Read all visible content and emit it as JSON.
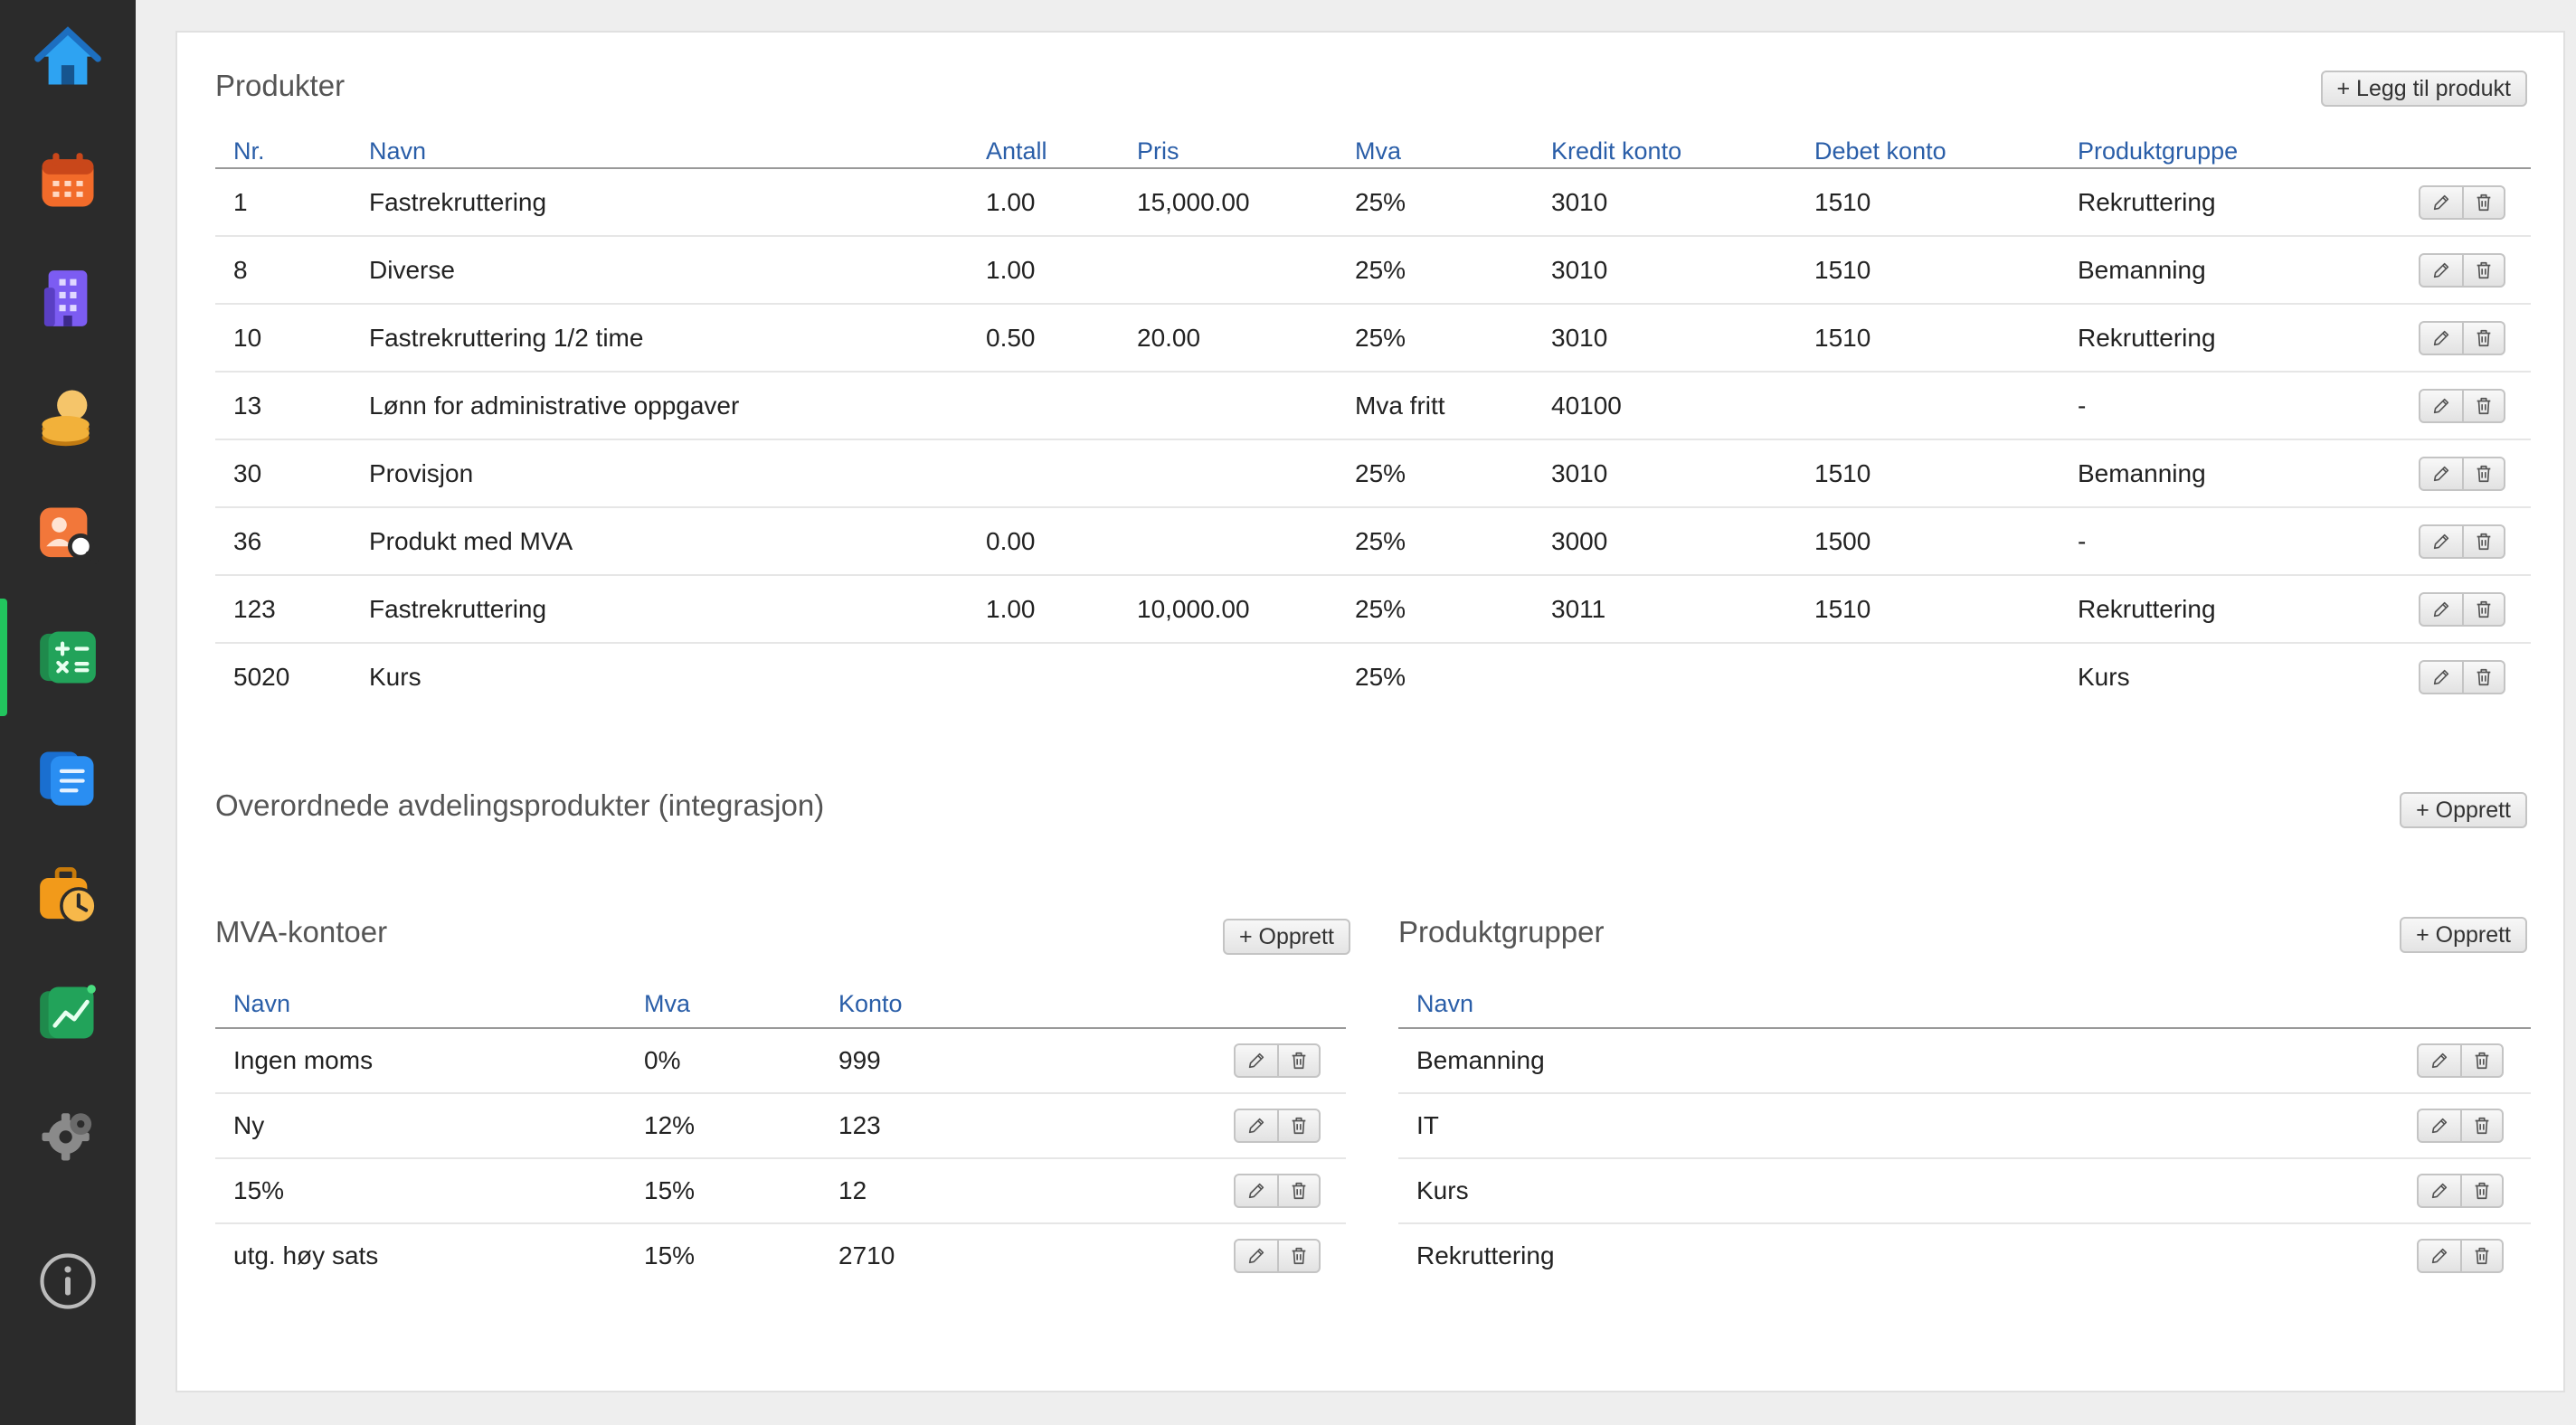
{
  "sidebar": {
    "items": [
      {
        "icon": "home-icon",
        "color": "#2ea3f2"
      },
      {
        "icon": "calendar-icon",
        "color": "#f26b2a"
      },
      {
        "icon": "building-icon",
        "color": "#7c5cf2"
      },
      {
        "icon": "coins-icon",
        "color": "#f2b13a"
      },
      {
        "icon": "person-search-icon",
        "color": "#f2773a"
      },
      {
        "icon": "calculator-icon",
        "color": "#22a35a",
        "active": true
      },
      {
        "icon": "document-list-icon",
        "color": "#2a8ef2"
      },
      {
        "icon": "briefcase-clock-icon",
        "color": "#f29a1a"
      },
      {
        "icon": "chart-icon",
        "color": "#22a35a"
      },
      {
        "icon": "gear-icon",
        "color": "#9a9a9a"
      },
      {
        "icon": "info-icon",
        "color": "#bbbbbb"
      }
    ]
  },
  "products": {
    "title": "Produkter",
    "add_label": "+ Legg til produkt",
    "headers": {
      "nr": "Nr.",
      "navn": "Navn",
      "antall": "Antall",
      "pris": "Pris",
      "mva": "Mva",
      "kredit": "Kredit konto",
      "debet": "Debet konto",
      "gruppe": "Produktgruppe"
    },
    "rows": [
      {
        "nr": "1",
        "navn": "Fastrekruttering",
        "antall": "1.00",
        "pris": "15,000.00",
        "mva": "25%",
        "kredit": "3010",
        "debet": "1510",
        "gruppe": "Rekruttering"
      },
      {
        "nr": "8",
        "navn": "Diverse",
        "antall": "1.00",
        "pris": "",
        "mva": "25%",
        "kredit": "3010",
        "debet": "1510",
        "gruppe": "Bemanning"
      },
      {
        "nr": "10",
        "navn": "Fastrekruttering 1/2 time",
        "antall": "0.50",
        "pris": "20.00",
        "mva": "25%",
        "kredit": "3010",
        "debet": "1510",
        "gruppe": "Rekruttering"
      },
      {
        "nr": "13",
        "navn": "Lønn for administrative oppgaver",
        "antall": "",
        "pris": "",
        "mva": "Mva fritt",
        "kredit": "40100",
        "debet": "",
        "gruppe": "-"
      },
      {
        "nr": "30",
        "navn": "Provisjon",
        "antall": "",
        "pris": "",
        "mva": "25%",
        "kredit": "3010",
        "debet": "1510",
        "gruppe": "Bemanning"
      },
      {
        "nr": "36",
        "navn": "Produkt med MVA",
        "antall": "0.00",
        "pris": "",
        "mva": "25%",
        "kredit": "3000",
        "debet": "1500",
        "gruppe": "-"
      },
      {
        "nr": "123",
        "navn": "Fastrekruttering",
        "antall": "1.00",
        "pris": "10,000.00",
        "mva": "25%",
        "kredit": "3011",
        "debet": "1510",
        "gruppe": "Rekruttering"
      },
      {
        "nr": "5020",
        "navn": "Kurs",
        "antall": "",
        "pris": "",
        "mva": "25%",
        "kredit": "",
        "debet": "",
        "gruppe": "Kurs"
      }
    ]
  },
  "parent_products": {
    "title": "Overordnede avdelingsprodukter (integrasjon)",
    "create_label": "+ Opprett"
  },
  "vat_accounts": {
    "title": "MVA-kontoer",
    "create_label": "+ Opprett",
    "headers": {
      "navn": "Navn",
      "mva": "Mva",
      "konto": "Konto"
    },
    "rows": [
      {
        "navn": "Ingen moms",
        "mva": "0%",
        "konto": "999"
      },
      {
        "navn": "Ny",
        "mva": "12%",
        "konto": "123"
      },
      {
        "navn": "15%",
        "mva": "15%",
        "konto": "12"
      },
      {
        "navn": "utg. høy sats",
        "mva": "15%",
        "konto": "2710"
      }
    ]
  },
  "product_groups": {
    "title": "Produktgrupper",
    "create_label": "+ Opprett",
    "headers": {
      "navn": "Navn"
    },
    "rows": [
      {
        "navn": "Bemanning"
      },
      {
        "navn": "IT"
      },
      {
        "navn": "Kurs"
      },
      {
        "navn": "Rekruttering"
      }
    ]
  },
  "icons": {
    "edit": "pencil-icon",
    "delete": "trash-icon"
  }
}
